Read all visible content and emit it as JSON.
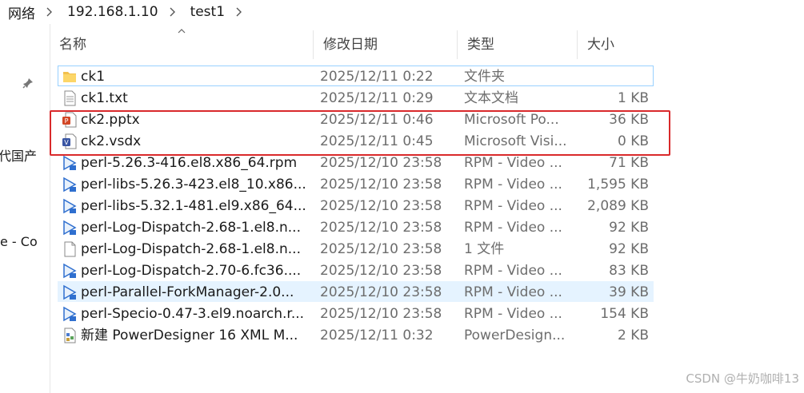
{
  "breadcrumb": {
    "items": [
      "网络",
      "192.168.1.10",
      "test1"
    ]
  },
  "navpane": {
    "items": [
      "代国产",
      "e - Co"
    ]
  },
  "columns": {
    "name": "名称",
    "date": "修改日期",
    "type": "类型",
    "size": "大小"
  },
  "files": [
    {
      "name": "ck1",
      "date": "2025/12/11 0:22",
      "type": "文件夹",
      "size": "",
      "icon": "folder-icon"
    },
    {
      "name": "ck1.txt",
      "date": "2025/12/11 0:29",
      "type": "文本文档",
      "size": "1 KB",
      "icon": "text-file-icon"
    },
    {
      "name": "ck2.pptx",
      "date": "2025/12/11 0:46",
      "type": "Microsoft Po...",
      "size": "36 KB",
      "icon": "powerpoint-icon"
    },
    {
      "name": "ck2.vsdx",
      "date": "2025/12/11 0:45",
      "type": "Microsoft Visi...",
      "size": "0 KB",
      "icon": "visio-icon"
    },
    {
      "name": "perl-5.26.3-416.el8.x86_64.rpm",
      "date": "2025/12/10 23:58",
      "type": "RPM - Video ...",
      "size": "71 KB",
      "icon": "video-file-icon"
    },
    {
      "name": "perl-libs-5.26.3-423.el8_10.x86...",
      "date": "2025/12/10 23:58",
      "type": "RPM - Video ...",
      "size": "1,595 KB",
      "icon": "video-file-icon"
    },
    {
      "name": "perl-libs-5.32.1-481.el9.x86_64...",
      "date": "2025/12/10 23:58",
      "type": "RPM - Video ...",
      "size": "2,089 KB",
      "icon": "video-file-icon"
    },
    {
      "name": "perl-Log-Dispatch-2.68-1.el8.n...",
      "date": "2025/12/10 23:58",
      "type": "RPM - Video ...",
      "size": "92 KB",
      "icon": "video-file-icon"
    },
    {
      "name": "perl-Log-Dispatch-2.68-1.el8.n...",
      "date": "2025/12/10 23:58",
      "type": "1 文件",
      "size": "92 KB",
      "icon": "blank-file-icon"
    },
    {
      "name": "perl-Log-Dispatch-2.70-6.fc36....",
      "date": "2025/12/10 23:58",
      "type": "RPM - Video ...",
      "size": "83 KB",
      "icon": "video-file-icon"
    },
    {
      "name": "perl-Parallel-ForkManager-2.0...",
      "date": "2025/12/10 23:58",
      "type": "RPM - Video ...",
      "size": "39 KB",
      "icon": "video-file-icon"
    },
    {
      "name": "perl-Specio-0.47-3.el9.noarch.r...",
      "date": "2025/12/10 23:58",
      "type": "RPM - Video ...",
      "size": "154 KB",
      "icon": "video-file-icon"
    },
    {
      "name": "新建 PowerDesigner 16 XML M...",
      "date": "2025/12/11 0:32",
      "type": "PowerDesign...",
      "size": "2 KB",
      "icon": "powerdesigner-icon"
    }
  ],
  "highlight_color": "#d9292b",
  "watermark": "CSDN @牛奶咖啡13"
}
